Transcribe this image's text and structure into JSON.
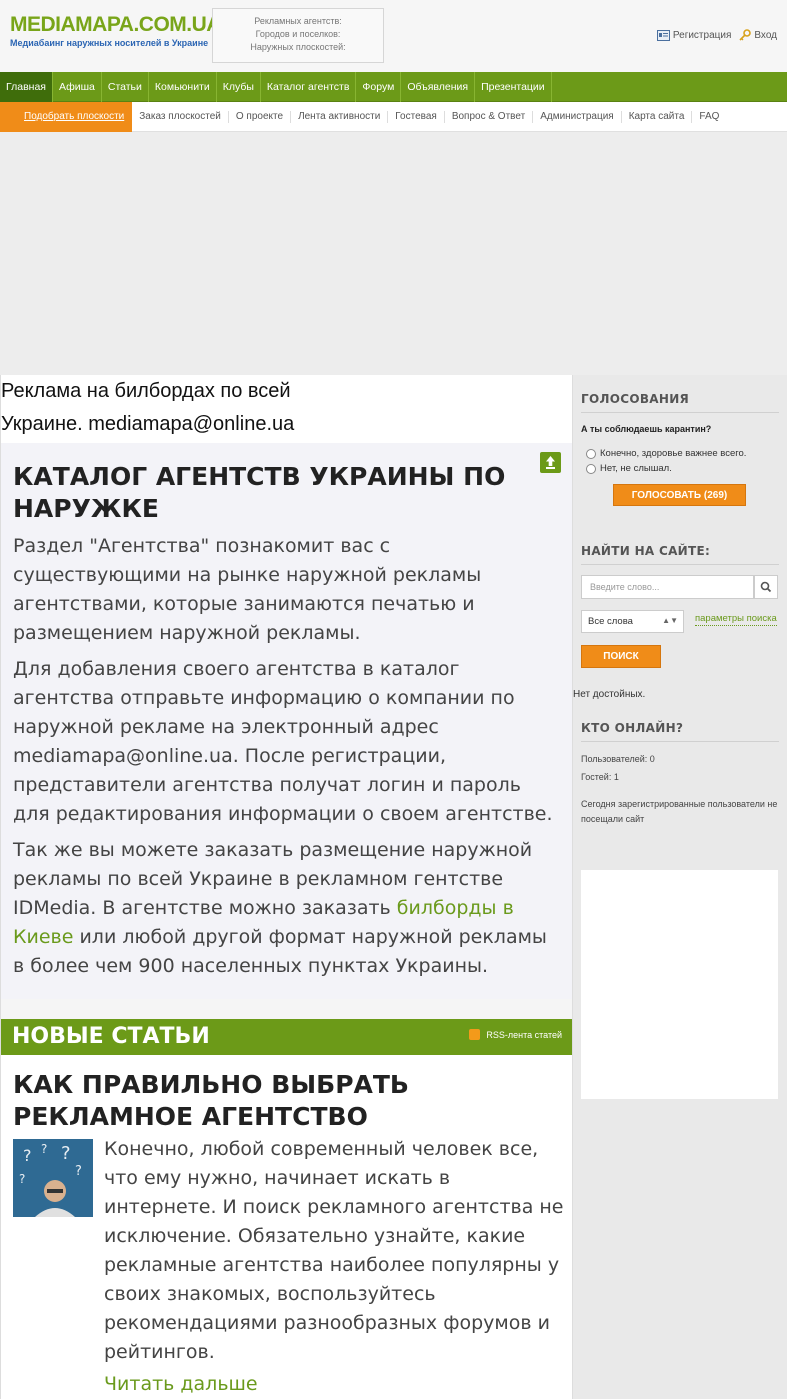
{
  "header": {
    "logo_title": "MEDIAMAPA.COM.UA",
    "logo_subtitle": "Медиабаинг наружных носителей в Украине",
    "stats": {
      "agencies": "Рекламных агентств:",
      "cities": "Городов и поселков:",
      "surfaces": "Наружных плоскостей:"
    },
    "register_label": "Регистрация",
    "login_label": "Вход"
  },
  "main_nav": [
    "Главная",
    "Афиша",
    "Статьи",
    "Комьюнити",
    "Клубы",
    "Каталог агентств",
    "Форум",
    "Объявления",
    "Презентации"
  ],
  "sub_nav": [
    "Подобрать плоскости",
    "Заказ плоскостей",
    "О проекте",
    "Лента активности",
    "Гостевая",
    "Вопрос & Ответ",
    "Администрация",
    "Карта сайта",
    "FAQ"
  ],
  "ad_text": {
    "line1": "Реклама на билбордах по всей",
    "line2": "Украине. mediamapa@online.ua"
  },
  "catalog": {
    "title": "КАТАЛОГ АГЕНТСТВ УКРАИНЫ ПО НАРУЖКЕ",
    "p1": "Раздел \"Агентства\" познакомит вас с существующими на рынке наружной рекламы агентствами, которые занимаются печатью и размещением наружной рекламы.",
    "p2": "Для добавления своего агентства в каталог агентства отправьте информацию о компании по наружной рекламе на электронный адрес mediamapa@online.ua. После регистрации, представители агентства получат логин и пароль для редактирования информации о своем агентстве.",
    "p3_before": "Так же вы можете заказать размещение наружной рекламы по всей Украине в рекламном гентстве IDMedia. В агентстве можно заказать ",
    "p3_link": "билборды в Киеве",
    "p3_after": " или любой другой формат наружной рекламы в более чем 900 населенных пунктах Украины."
  },
  "news": {
    "title": "НОВЫЕ СТАТЬИ",
    "rss_label": "RSS-лента статей",
    "article_title": "КАК ПРАВИЛЬНО ВЫБРАТЬ РЕКЛАМНОЕ АГЕНТСТВО",
    "article_body": "Конечно, любой современный человек все, что ему нужно, начинает искать в интернете. И поиск рекламного агентства не исключение. Обязательно узнайте, какие рекламные агентства наиболее популярны у своих знакомых, воспользуйтесь рекомендациями разнообразных форумов и рейтингов.",
    "read_more": "Читать дальше"
  },
  "sidebar": {
    "poll_heading": "ГОЛОСОВАНИЯ",
    "poll_question": "А ты соблюдаешь карантин?",
    "poll_options": [
      "Конечно, здоровье важнее всего.",
      "Нет, не слышал."
    ],
    "vote_button": "ГОЛОСОВАТЬ (269)",
    "search_heading": "НАЙТИ НА САЙТЕ:",
    "search_placeholder": "Введите слово...",
    "search_mode": "Все слова",
    "search_params": "параметры поиска",
    "search_button": "ПОИСК",
    "no_results": "Нет достойных.",
    "online_heading": "КТО ОНЛАЙН?",
    "users_online": "Пользователей: 0",
    "guests_online": "Гостей: 1",
    "registered_today": "Сегодня зарегистрированные пользователи не посещали сайт"
  },
  "colors": {
    "green": "#6c9a18",
    "dark_green": "#3f6d0b",
    "orange": "#f08c18",
    "link_green": "#6a9a1c"
  }
}
